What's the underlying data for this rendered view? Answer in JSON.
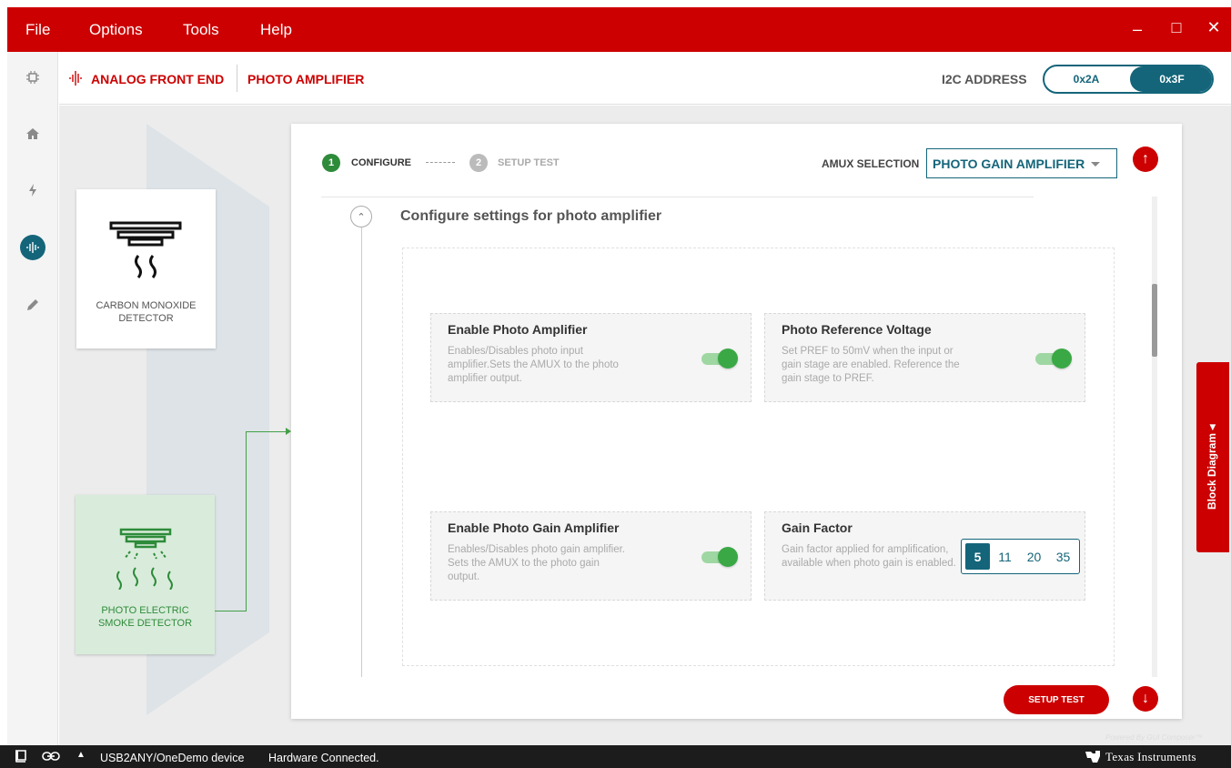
{
  "menu": {
    "items": [
      "File",
      "Options",
      "Tools",
      "Help"
    ],
    "window_controls": [
      "minimize",
      "maximize",
      "close"
    ]
  },
  "header": {
    "breadcrumb_primary": "ANALOG FRONT END",
    "breadcrumb_secondary": "PHOTO AMPLIFIER",
    "i2c_label": "I2C ADDRESS",
    "i2c_options": [
      "0x2A",
      "0x3F"
    ],
    "i2c_selected": "0x3F"
  },
  "rail": {
    "icons": [
      "chip-icon",
      "home-icon",
      "flash-icon",
      "waveform-icon",
      "pencil-icon"
    ],
    "active": "waveform-icon"
  },
  "detectors": [
    {
      "label_line1": "CARBON MONOXIDE",
      "label_line2": "DETECTOR",
      "selected": false
    },
    {
      "label_line1": "PHOTO ELECTRIC",
      "label_line2": "SMOKE DETECTOR",
      "selected": true
    }
  ],
  "steps": [
    {
      "num": "1",
      "label": "CONFIGURE",
      "active": true
    },
    {
      "num": "2",
      "label": "SETUP TEST",
      "active": false
    }
  ],
  "amux": {
    "label": "AMUX SELECTION",
    "value": "PHOTO GAIN AMPLIFIER"
  },
  "section": {
    "title": "Configure settings for photo amplifier"
  },
  "settings": [
    {
      "title": "Enable Photo Amplifier",
      "desc": "Enables/Disables photo input amplifier.Sets the AMUX to the photo amplifier output.",
      "enabled": true
    },
    {
      "title": "Photo Reference Voltage",
      "desc": "Set PREF to 50mV when the input or gain stage are enabled. Reference the gain stage to PREF.",
      "enabled": true
    },
    {
      "title": "Enable Photo Gain Amplifier",
      "desc": "Enables/Disables photo gain amplifier. Sets the AMUX to the photo gain output.",
      "enabled": true
    },
    {
      "title": "Gain Factor",
      "desc": "Gain factor applied for amplification, available when photo gain is enabled."
    }
  ],
  "gain_factor": {
    "options": [
      "5",
      "11",
      "20",
      "35"
    ],
    "selected": "5"
  },
  "buttons": {
    "setup_test": "SETUP TEST",
    "block_diagram": "Block Diagram ◂"
  },
  "footer": {
    "powered_by": "Powered By GUI Composer™"
  },
  "statusbar": {
    "device": "USB2ANY/OneDemo device",
    "status": "Hardware Connected.",
    "brand": "Texas Instruments"
  },
  "colors": {
    "brand_red": "#cc0000",
    "accent_teal": "#14657a",
    "toggle_green": "#3aa845"
  }
}
